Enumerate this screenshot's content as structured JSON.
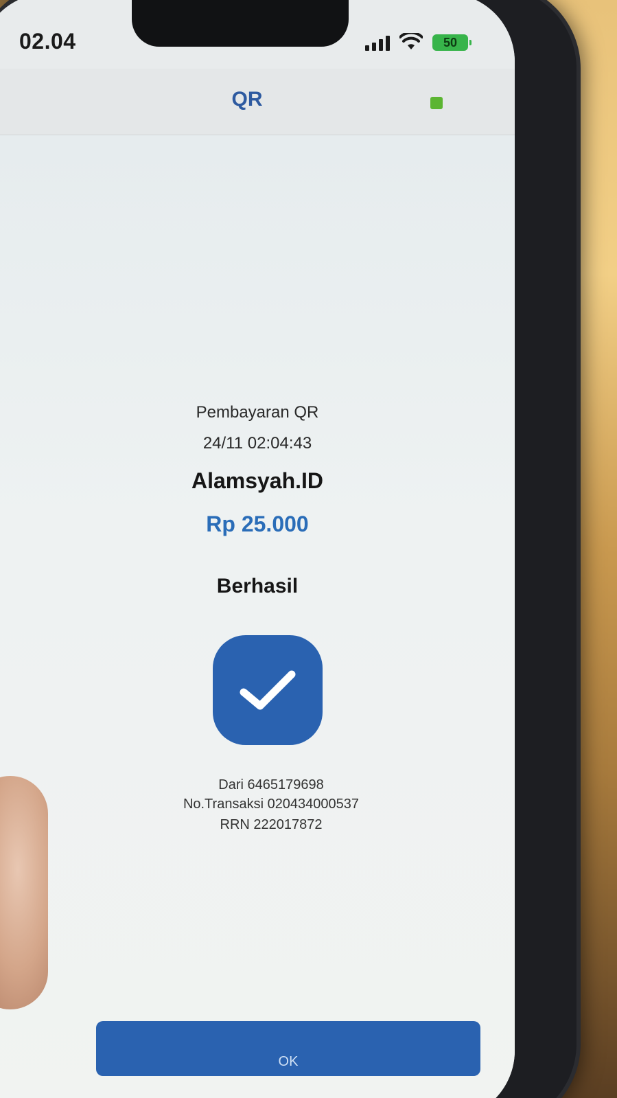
{
  "status_bar": {
    "time": "02.04",
    "battery_level": "50"
  },
  "navbar": {
    "title": "QR"
  },
  "receipt": {
    "payment_type": "Pembayaran QR",
    "datetime": "24/11 02:04:43",
    "merchant": "Alamsyah.ID",
    "amount": "Rp 25.000",
    "status": "Berhasil",
    "from": "Dari 6465179698",
    "transaction_no": "No.Transaksi 020434000537",
    "rrn": "RRN 222017872"
  },
  "actions": {
    "ok_label": "OK"
  },
  "colors": {
    "accent": "#2a62b0",
    "amount": "#2a6db8",
    "battery": "#37b44a",
    "indicator": "#5bb532"
  },
  "icons": {
    "status_check": "checkmark-icon"
  }
}
